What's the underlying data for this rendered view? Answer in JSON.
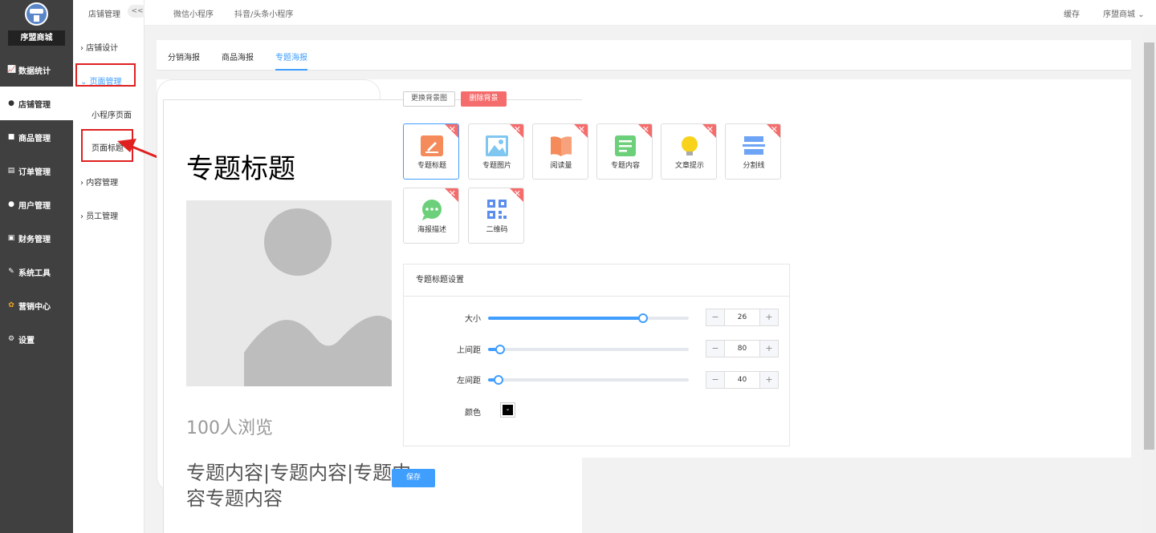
{
  "app": {
    "shop_name": "序盟商城"
  },
  "nav": [
    {
      "label": "数据统计",
      "icon": "chart-icon"
    },
    {
      "label": "店铺管理",
      "icon": "store-icon"
    },
    {
      "label": "商品管理",
      "icon": "goods-icon"
    },
    {
      "label": "订单管理",
      "icon": "order-icon"
    },
    {
      "label": "用户管理",
      "icon": "user-icon"
    },
    {
      "label": "财务管理",
      "icon": "finance-icon"
    },
    {
      "label": "系统工具",
      "icon": "wrench-icon"
    },
    {
      "label": "营销中心",
      "icon": "marketing-icon"
    },
    {
      "label": "设置",
      "icon": "gear-icon"
    }
  ],
  "subnav": {
    "title": "店铺管理",
    "collapse": "<<",
    "items": [
      "店铺设计",
      "页面管理",
      "小程序页面",
      "页面标题",
      "内容管理",
      "员工管理"
    ]
  },
  "topbar": {
    "tabs": [
      "微信小程序",
      "抖音/头条小程序"
    ],
    "cache": "缓存",
    "user": "序盟商城"
  },
  "poster_tabs": [
    "分销海报",
    "商品海报",
    "专题海报"
  ],
  "poster": {
    "title": "专题标题",
    "views": "100人浏览",
    "content": "专题内容|专题内容|专题内容专题内容"
  },
  "buttons": {
    "change_bg": "更换背景图",
    "delete_bg": "删除背景",
    "save": "保存"
  },
  "components": [
    {
      "label": "专题标题",
      "icon": "title-icon"
    },
    {
      "label": "专题图片",
      "icon": "image-icon"
    },
    {
      "label": "阅读量",
      "icon": "book-icon"
    },
    {
      "label": "专题内容",
      "icon": "content-icon"
    },
    {
      "label": "文章提示",
      "icon": "bulb-icon"
    },
    {
      "label": "分割线",
      "icon": "divider-icon"
    },
    {
      "label": "海报描述",
      "icon": "chat-icon"
    },
    {
      "label": "二维码",
      "icon": "qrcode-icon"
    }
  ],
  "settings": {
    "title": "专题标题设置",
    "rows": [
      {
        "label": "大小",
        "value": "26",
        "fraction": 0.77
      },
      {
        "label": "上间距",
        "value": "80",
        "fraction": 0.06
      },
      {
        "label": "左间距",
        "value": "40",
        "fraction": 0.05
      }
    ],
    "color_label": "颜色",
    "color_value": "#000000"
  }
}
